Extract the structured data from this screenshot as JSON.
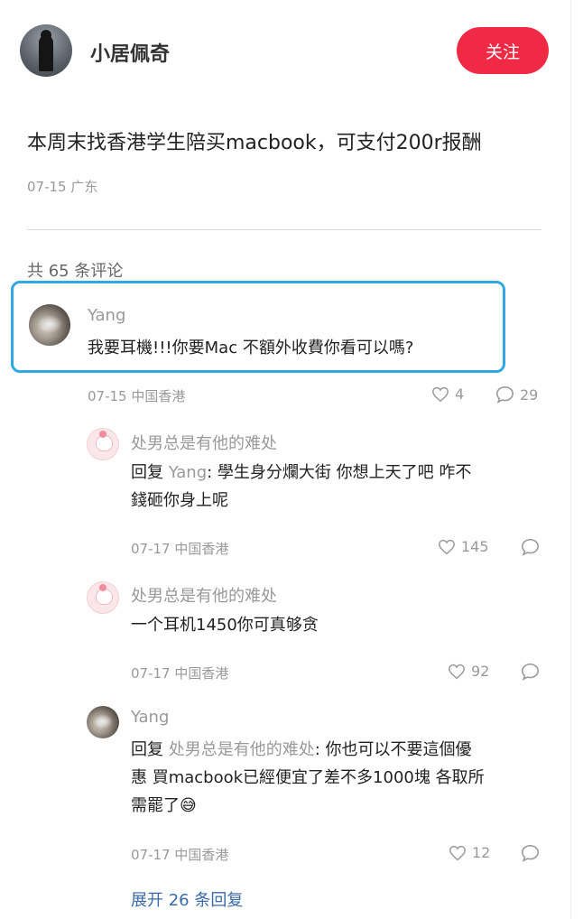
{
  "post": {
    "author": "小居佩奇",
    "follow_label": "关注",
    "title": "本周末找香港学生陪买macbook，可支付200r报酬",
    "meta": "07-15 广东"
  },
  "comments_header": "共 65 条评论",
  "comment_main": {
    "name": "Yang",
    "text": "我要耳機!!!你要Mac 不額外收費你看可以嗎?",
    "meta": "07-15 中国香港",
    "likes": "4",
    "replies": "29"
  },
  "replies": [
    {
      "name": "处男总是有他的难处",
      "prefix": "回复 ",
      "target": "Yang",
      "text_line1": ": 學生身分爛大街 你想上天了吧 咋不",
      "text_line2": "錢砸你身上呢",
      "meta": "07-17 中国香港",
      "likes": "145"
    },
    {
      "name": "处男总是有他的难处",
      "text": "一个耳机1450你可真够贪",
      "meta": "07-17 中国香港",
      "likes": "92"
    },
    {
      "name": "Yang",
      "prefix": "回复 ",
      "target": "处男总是有他的难处",
      "text_line1": ": 你也可以不要這個優",
      "text_line2": "惠 買macbook已經便宜了差不多1000塊 各取所",
      "text_line3": "需罷了",
      "emoji": "😅",
      "meta": "07-17 中国香港",
      "likes": "12"
    }
  ],
  "expand_label": "展开 26 条回复",
  "colors": {
    "accent": "#f02a44",
    "highlight": "#2fa8e3",
    "link": "#3b6aa8"
  },
  "icons": [
    "heart-icon",
    "comment-icon"
  ]
}
